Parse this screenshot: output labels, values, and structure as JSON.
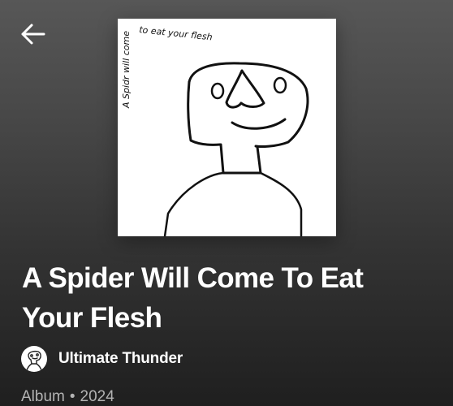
{
  "header": {
    "back_icon": "arrow-left-icon"
  },
  "album": {
    "cover_text": "A Spider will come to eat your flesh",
    "title": "A Spider Will Come To Eat Your Flesh",
    "artist": {
      "name": "Ultimate Thunder",
      "avatar_icon": "artist-avatar"
    },
    "type": "Album",
    "separator": "•",
    "year": "2024"
  },
  "colors": {
    "background_top": "#575757",
    "background_bottom": "#1f1f1f",
    "title_text": "#ffffff",
    "meta_text": "#b3b3b3"
  }
}
